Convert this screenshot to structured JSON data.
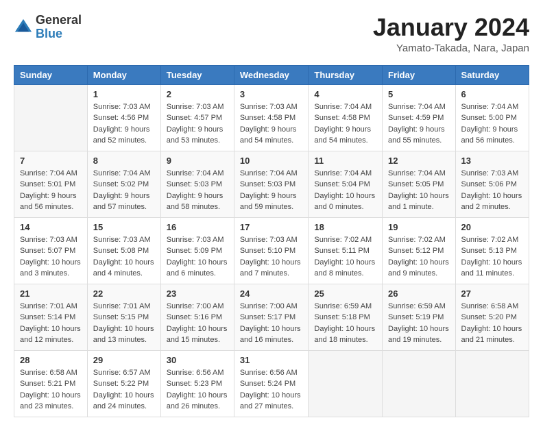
{
  "header": {
    "logo_general": "General",
    "logo_blue": "Blue",
    "month_title": "January 2024",
    "location": "Yamato-Takada, Nara, Japan"
  },
  "days_of_week": [
    "Sunday",
    "Monday",
    "Tuesday",
    "Wednesday",
    "Thursday",
    "Friday",
    "Saturday"
  ],
  "weeks": [
    [
      {
        "day": "",
        "info": ""
      },
      {
        "day": "1",
        "info": "Sunrise: 7:03 AM\nSunset: 4:56 PM\nDaylight: 9 hours\nand 52 minutes."
      },
      {
        "day": "2",
        "info": "Sunrise: 7:03 AM\nSunset: 4:57 PM\nDaylight: 9 hours\nand 53 minutes."
      },
      {
        "day": "3",
        "info": "Sunrise: 7:03 AM\nSunset: 4:58 PM\nDaylight: 9 hours\nand 54 minutes."
      },
      {
        "day": "4",
        "info": "Sunrise: 7:04 AM\nSunset: 4:58 PM\nDaylight: 9 hours\nand 54 minutes."
      },
      {
        "day": "5",
        "info": "Sunrise: 7:04 AM\nSunset: 4:59 PM\nDaylight: 9 hours\nand 55 minutes."
      },
      {
        "day": "6",
        "info": "Sunrise: 7:04 AM\nSunset: 5:00 PM\nDaylight: 9 hours\nand 56 minutes."
      }
    ],
    [
      {
        "day": "7",
        "info": "Sunrise: 7:04 AM\nSunset: 5:01 PM\nDaylight: 9 hours\nand 56 minutes."
      },
      {
        "day": "8",
        "info": "Sunrise: 7:04 AM\nSunset: 5:02 PM\nDaylight: 9 hours\nand 57 minutes."
      },
      {
        "day": "9",
        "info": "Sunrise: 7:04 AM\nSunset: 5:03 PM\nDaylight: 9 hours\nand 58 minutes."
      },
      {
        "day": "10",
        "info": "Sunrise: 7:04 AM\nSunset: 5:03 PM\nDaylight: 9 hours\nand 59 minutes."
      },
      {
        "day": "11",
        "info": "Sunrise: 7:04 AM\nSunset: 5:04 PM\nDaylight: 10 hours\nand 0 minutes."
      },
      {
        "day": "12",
        "info": "Sunrise: 7:04 AM\nSunset: 5:05 PM\nDaylight: 10 hours\nand 1 minute."
      },
      {
        "day": "13",
        "info": "Sunrise: 7:03 AM\nSunset: 5:06 PM\nDaylight: 10 hours\nand 2 minutes."
      }
    ],
    [
      {
        "day": "14",
        "info": "Sunrise: 7:03 AM\nSunset: 5:07 PM\nDaylight: 10 hours\nand 3 minutes."
      },
      {
        "day": "15",
        "info": "Sunrise: 7:03 AM\nSunset: 5:08 PM\nDaylight: 10 hours\nand 4 minutes."
      },
      {
        "day": "16",
        "info": "Sunrise: 7:03 AM\nSunset: 5:09 PM\nDaylight: 10 hours\nand 6 minutes."
      },
      {
        "day": "17",
        "info": "Sunrise: 7:03 AM\nSunset: 5:10 PM\nDaylight: 10 hours\nand 7 minutes."
      },
      {
        "day": "18",
        "info": "Sunrise: 7:02 AM\nSunset: 5:11 PM\nDaylight: 10 hours\nand 8 minutes."
      },
      {
        "day": "19",
        "info": "Sunrise: 7:02 AM\nSunset: 5:12 PM\nDaylight: 10 hours\nand 9 minutes."
      },
      {
        "day": "20",
        "info": "Sunrise: 7:02 AM\nSunset: 5:13 PM\nDaylight: 10 hours\nand 11 minutes."
      }
    ],
    [
      {
        "day": "21",
        "info": "Sunrise: 7:01 AM\nSunset: 5:14 PM\nDaylight: 10 hours\nand 12 minutes."
      },
      {
        "day": "22",
        "info": "Sunrise: 7:01 AM\nSunset: 5:15 PM\nDaylight: 10 hours\nand 13 minutes."
      },
      {
        "day": "23",
        "info": "Sunrise: 7:00 AM\nSunset: 5:16 PM\nDaylight: 10 hours\nand 15 minutes."
      },
      {
        "day": "24",
        "info": "Sunrise: 7:00 AM\nSunset: 5:17 PM\nDaylight: 10 hours\nand 16 minutes."
      },
      {
        "day": "25",
        "info": "Sunrise: 6:59 AM\nSunset: 5:18 PM\nDaylight: 10 hours\nand 18 minutes."
      },
      {
        "day": "26",
        "info": "Sunrise: 6:59 AM\nSunset: 5:19 PM\nDaylight: 10 hours\nand 19 minutes."
      },
      {
        "day": "27",
        "info": "Sunrise: 6:58 AM\nSunset: 5:20 PM\nDaylight: 10 hours\nand 21 minutes."
      }
    ],
    [
      {
        "day": "28",
        "info": "Sunrise: 6:58 AM\nSunset: 5:21 PM\nDaylight: 10 hours\nand 23 minutes."
      },
      {
        "day": "29",
        "info": "Sunrise: 6:57 AM\nSunset: 5:22 PM\nDaylight: 10 hours\nand 24 minutes."
      },
      {
        "day": "30",
        "info": "Sunrise: 6:56 AM\nSunset: 5:23 PM\nDaylight: 10 hours\nand 26 minutes."
      },
      {
        "day": "31",
        "info": "Sunrise: 6:56 AM\nSunset: 5:24 PM\nDaylight: 10 hours\nand 27 minutes."
      },
      {
        "day": "",
        "info": ""
      },
      {
        "day": "",
        "info": ""
      },
      {
        "day": "",
        "info": ""
      }
    ]
  ]
}
